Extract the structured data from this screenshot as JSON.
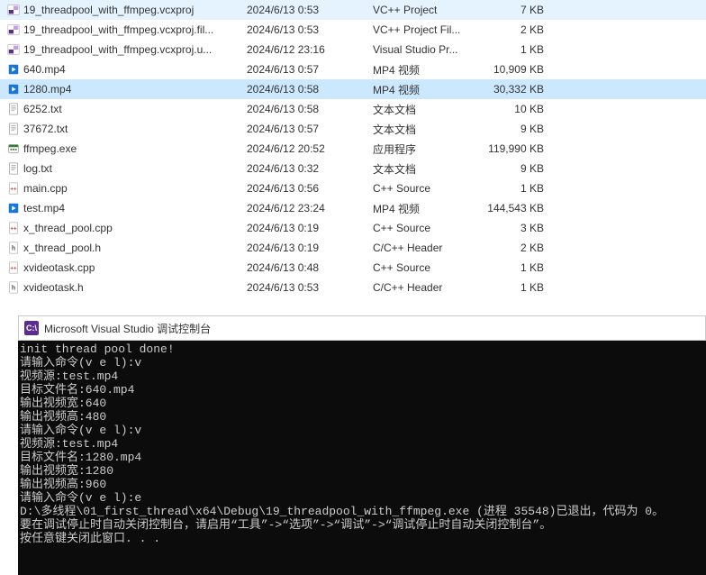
{
  "files": [
    {
      "icon": "vcxproj",
      "name": "19_threadpool_with_ffmpeg.vcxproj",
      "date": "2024/6/13 0:53",
      "type": "VC++ Project",
      "size": "7 KB"
    },
    {
      "icon": "vcxproj",
      "name": "19_threadpool_with_ffmpeg.vcxproj.fil...",
      "date": "2024/6/13 0:53",
      "type": "VC++ Project Fil...",
      "size": "2 KB"
    },
    {
      "icon": "user",
      "name": "19_threadpool_with_ffmpeg.vcxproj.u...",
      "date": "2024/6/12 23:16",
      "type": "Visual Studio Pr...",
      "size": "1 KB"
    },
    {
      "icon": "mp4",
      "name": "640.mp4",
      "date": "2024/6/13 0:57",
      "type": "MP4 视频",
      "size": "10,909 KB"
    },
    {
      "icon": "mp4",
      "name": "1280.mp4",
      "date": "2024/6/13 0:58",
      "type": "MP4 视频",
      "size": "30,332 KB",
      "selected": true
    },
    {
      "icon": "txt",
      "name": "6252.txt",
      "date": "2024/6/13 0:58",
      "type": "文本文档",
      "size": "10 KB"
    },
    {
      "icon": "txt",
      "name": "37672.txt",
      "date": "2024/6/13 0:57",
      "type": "文本文档",
      "size": "9 KB"
    },
    {
      "icon": "exe",
      "name": "ffmpeg.exe",
      "date": "2024/6/12 20:52",
      "type": "应用程序",
      "size": "119,990 KB"
    },
    {
      "icon": "txt",
      "name": "log.txt",
      "date": "2024/6/13 0:32",
      "type": "文本文档",
      "size": "9 KB"
    },
    {
      "icon": "cpp",
      "name": "main.cpp",
      "date": "2024/6/13 0:56",
      "type": "C++ Source",
      "size": "1 KB"
    },
    {
      "icon": "mp4",
      "name": "test.mp4",
      "date": "2024/6/12 23:24",
      "type": "MP4 视频",
      "size": "144,543 KB"
    },
    {
      "icon": "cpp",
      "name": "x_thread_pool.cpp",
      "date": "2024/6/13 0:19",
      "type": "C++ Source",
      "size": "3 KB"
    },
    {
      "icon": "h",
      "name": "x_thread_pool.h",
      "date": "2024/6/13 0:19",
      "type": "C/C++ Header",
      "size": "2 KB"
    },
    {
      "icon": "cpp",
      "name": "xvideotask.cpp",
      "date": "2024/6/13 0:48",
      "type": "C++ Source",
      "size": "1 KB"
    },
    {
      "icon": "h",
      "name": "xvideotask.h",
      "date": "2024/6/13 0:53",
      "type": "C/C++ Header",
      "size": "1 KB"
    }
  ],
  "console": {
    "title": "Microsoft Visual Studio 调试控制台",
    "lines": [
      "init thread pool done!",
      "请输入命令(v e l):v",
      "视频源:test.mp4",
      "目标文件名:640.mp4",
      "输出视频宽:640",
      "输出视频高:480",
      "请输入命令(v e l):v",
      "视频源:test.mp4",
      "目标文件名:1280.mp4",
      "输出视频宽:1280",
      "输出视频高:960",
      "请输入命令(v e l):e",
      "",
      "D:\\多线程\\01_first_thread\\x64\\Debug\\19_threadpool_with_ffmpeg.exe (进程 35548)已退出，代码为 0。",
      "要在调试停止时自动关闭控制台，请启用“工具”->“选项”->“调试”->“调试停止时自动关闭控制台”。",
      "按任意键关闭此窗口. . ."
    ]
  },
  "icon_colors": {
    "vcxproj": "#5c2d91",
    "user": "#5c2d91",
    "mp4": "#1976d2",
    "txt": "#666",
    "exe": "#2e7d32",
    "cpp": "#d32f2f",
    "h": "#555"
  }
}
